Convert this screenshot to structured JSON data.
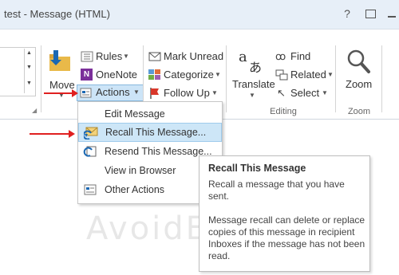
{
  "window": {
    "title": "test - Message (HTML)",
    "help_label": "?"
  },
  "ribbon": {
    "move": {
      "label": "Move"
    },
    "rules": {
      "label": "Rules"
    },
    "onenote": {
      "label": "OneNote"
    },
    "actions": {
      "label": "Actions"
    },
    "mark_unread": {
      "label": "Mark Unread"
    },
    "categorize": {
      "label": "Categorize"
    },
    "follow_up": {
      "label": "Follow Up"
    },
    "translate": {
      "label": "Translate"
    },
    "find": {
      "label": "Find"
    },
    "related": {
      "label": "Related"
    },
    "select": {
      "label": "Select"
    },
    "zoom": {
      "label": "Zoom"
    },
    "groups": {
      "editing": "Editing",
      "zoom": "Zoom"
    }
  },
  "actions_menu": {
    "items": [
      {
        "label": "Edit Message",
        "icon": "none"
      },
      {
        "label": "Recall This Message...",
        "icon": "recall-envelope-icon",
        "highlighted": true
      },
      {
        "label": "Resend This Message...",
        "icon": "resend-icon"
      },
      {
        "label": "View in Browser",
        "icon": "none"
      },
      {
        "label": "Other Actions",
        "icon": "other-actions-icon"
      }
    ]
  },
  "tooltip": {
    "title": "Recall This Message",
    "description": "Recall a message that you have sent.",
    "note": "Message recall can delete or replace copies of this message in recipient Inboxes if the message has not been read."
  },
  "watermark": {
    "text": "AvoidE"
  },
  "colors": {
    "accent_highlight": "#cde6f7",
    "arrow": "#e02020",
    "titlebar": "#e7eff8"
  }
}
